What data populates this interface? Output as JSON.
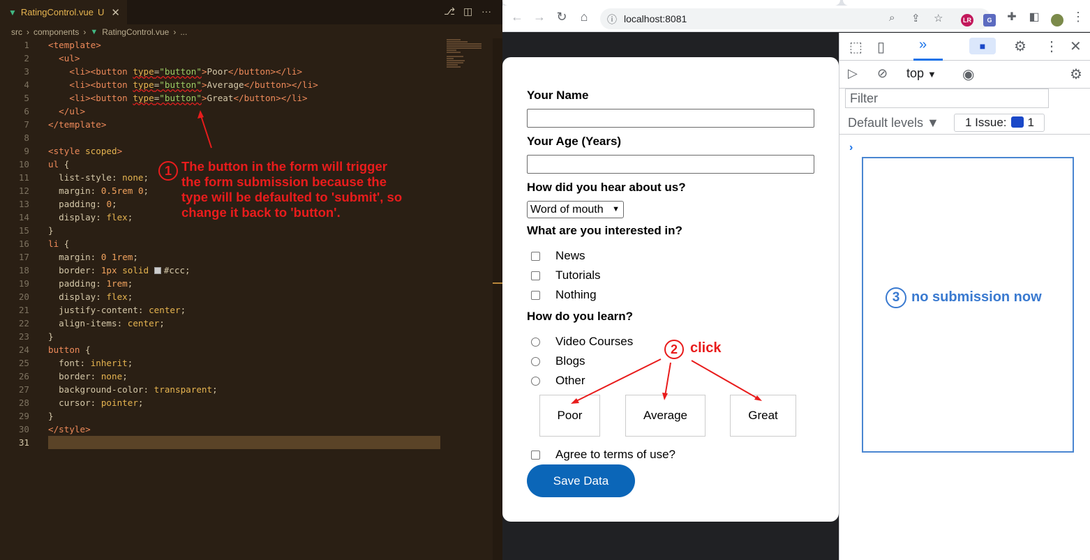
{
  "editor": {
    "tab": {
      "name": "RatingControl.vue",
      "modified": "U",
      "close": "✕"
    },
    "breadcrumb": {
      "path1": "src",
      "path2": "components",
      "file": "RatingControl.vue",
      "tail": "..."
    },
    "code": [
      {
        "n": "1"
      },
      {
        "n": "2"
      },
      {
        "n": "3"
      },
      {
        "n": "4"
      },
      {
        "n": "5"
      },
      {
        "n": "6"
      },
      {
        "n": "7"
      },
      {
        "n": "8"
      },
      {
        "n": "9"
      },
      {
        "n": "10"
      },
      {
        "n": "11"
      },
      {
        "n": "12"
      },
      {
        "n": "13"
      },
      {
        "n": "14"
      },
      {
        "n": "15"
      },
      {
        "n": "16"
      },
      {
        "n": "17"
      },
      {
        "n": "18"
      },
      {
        "n": "19"
      },
      {
        "n": "20"
      },
      {
        "n": "21"
      },
      {
        "n": "22"
      },
      {
        "n": "23"
      },
      {
        "n": "24"
      },
      {
        "n": "25"
      },
      {
        "n": "26"
      },
      {
        "n": "27"
      },
      {
        "n": "28"
      },
      {
        "n": "29"
      },
      {
        "n": "30"
      },
      {
        "n": "31"
      }
    ],
    "annotation_1": {
      "number": "1",
      "line1": "The button in the form will trigger",
      "line2": "the form submission because the",
      "line3": "type will be defaulted to 'submit', so",
      "line4": "change it back to 'button'."
    }
  },
  "browser": {
    "url": "localhost:8081",
    "form": {
      "name_label": "Your Name",
      "age_label": "Your Age (Years)",
      "referrer_label": "How did you hear about us?",
      "referrer_value": "Word of mouth",
      "interest_label": "What are you interested in?",
      "interests": [
        "News",
        "Tutorials",
        "Nothing"
      ],
      "learn_label": "How do you learn?",
      "learn_options": [
        "Video Courses",
        "Blogs",
        "Other"
      ],
      "rating": [
        "Poor",
        "Average",
        "Great"
      ],
      "terms_label": "Agree to terms of use?",
      "save_label": "Save Data"
    },
    "annotation_2": {
      "number": "2",
      "text": "click"
    },
    "devtools": {
      "context": "top",
      "filter_placeholder": "Filter",
      "levels": "Default levels ▼",
      "issues_label": "1 Issue:",
      "issues_count": "1",
      "annotation_3": {
        "number": "3",
        "text": "no submission now"
      }
    },
    "colors": {
      "accent": "#0b66b8",
      "annotation_red": "#e81c1c",
      "annotation_blue": "#3a7ad0"
    }
  }
}
